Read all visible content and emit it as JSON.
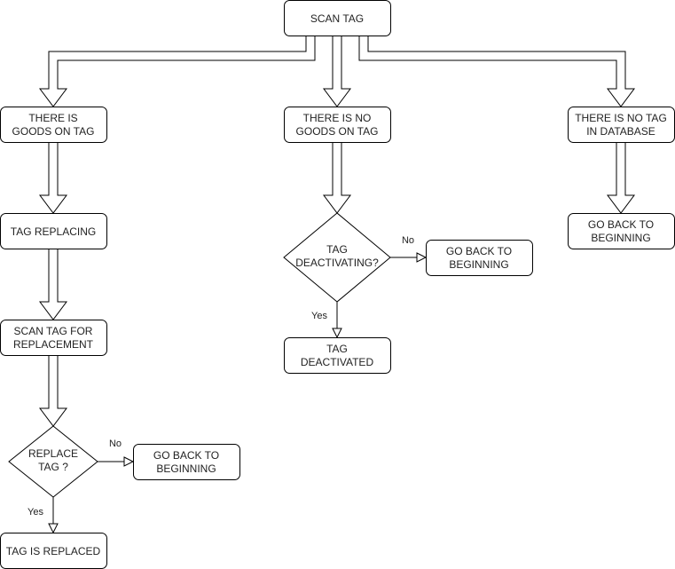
{
  "nodes": {
    "scan_tag": [
      "SCAN TAG"
    ],
    "goods_on_tag": [
      "THERE IS",
      "GOODS ON TAG"
    ],
    "no_goods_on_tag": [
      "THERE IS NO",
      "GOODS ON TAG"
    ],
    "no_tag_in_db": [
      "THERE IS NO TAG",
      "IN DATABASE"
    ],
    "tag_replacing": [
      "TAG REPLACING"
    ],
    "scan_for_replacement": [
      "SCAN TAG FOR",
      "REPLACEMENT"
    ],
    "replace_tag_decision": [
      "REPLACE",
      "TAG ?"
    ],
    "go_back_left": [
      "GO BACK TO",
      "BEGINNING"
    ],
    "tag_is_replaced": [
      "TAG IS REPLACED"
    ],
    "deactivating_decision": [
      "TAG",
      "DEACTIVATING?"
    ],
    "go_back_middle": [
      "GO BACK TO",
      "BEGINNING"
    ],
    "tag_deactivated": [
      "TAG",
      "DEACTIVATED"
    ],
    "go_back_right": [
      "GO BACK TO",
      "BEGINNING"
    ]
  },
  "edge_labels": {
    "replace_no": "No",
    "replace_yes": "Yes",
    "deactivate_no": "No",
    "deactivate_yes": "Yes"
  }
}
